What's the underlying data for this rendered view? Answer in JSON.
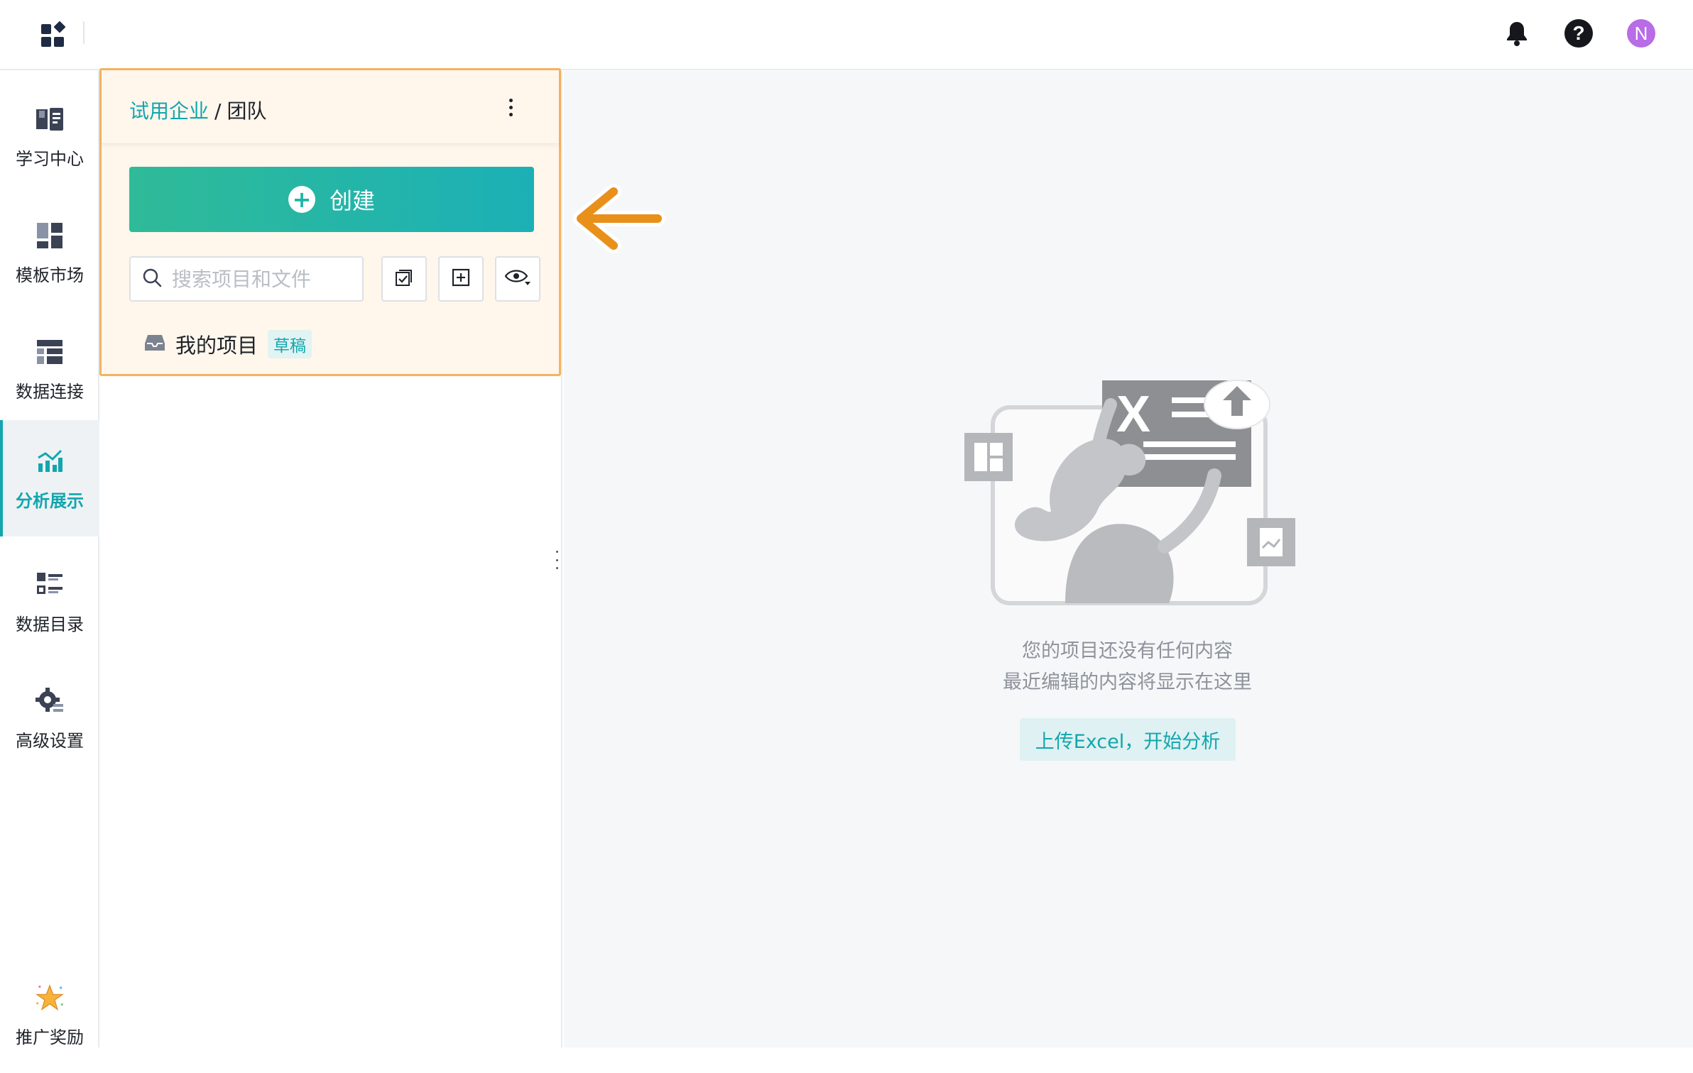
{
  "app": {
    "user_initial": "N"
  },
  "nav": {
    "items": [
      {
        "label": "学习中心",
        "icon": "book-icon"
      },
      {
        "label": "模板市场",
        "icon": "template-icon"
      },
      {
        "label": "数据连接",
        "icon": "database-icon"
      },
      {
        "label": "分析展示",
        "icon": "chart-icon",
        "active": true
      },
      {
        "label": "数据目录",
        "icon": "catalog-icon"
      },
      {
        "label": "高级设置",
        "icon": "gear-icon"
      }
    ],
    "bottom": {
      "label": "推广奖励",
      "icon": "star-icon"
    }
  },
  "panel": {
    "breadcrumb": {
      "root": "试用企业",
      "separator": "/",
      "current": "团队"
    },
    "create_label": "创建",
    "search_placeholder": "搜索项目和文件",
    "project": {
      "name": "我的项目",
      "tag": "草稿"
    }
  },
  "main": {
    "empty_line1": "您的项目还没有任何内容",
    "empty_line2": "最近编辑的内容将显示在这里",
    "upload_label": "上传Excel，开始分析"
  },
  "colors": {
    "accent": "#12a6ad",
    "highlight_border": "#f3b360",
    "arrow": "#e8901a",
    "avatar": "#b86ce6"
  }
}
